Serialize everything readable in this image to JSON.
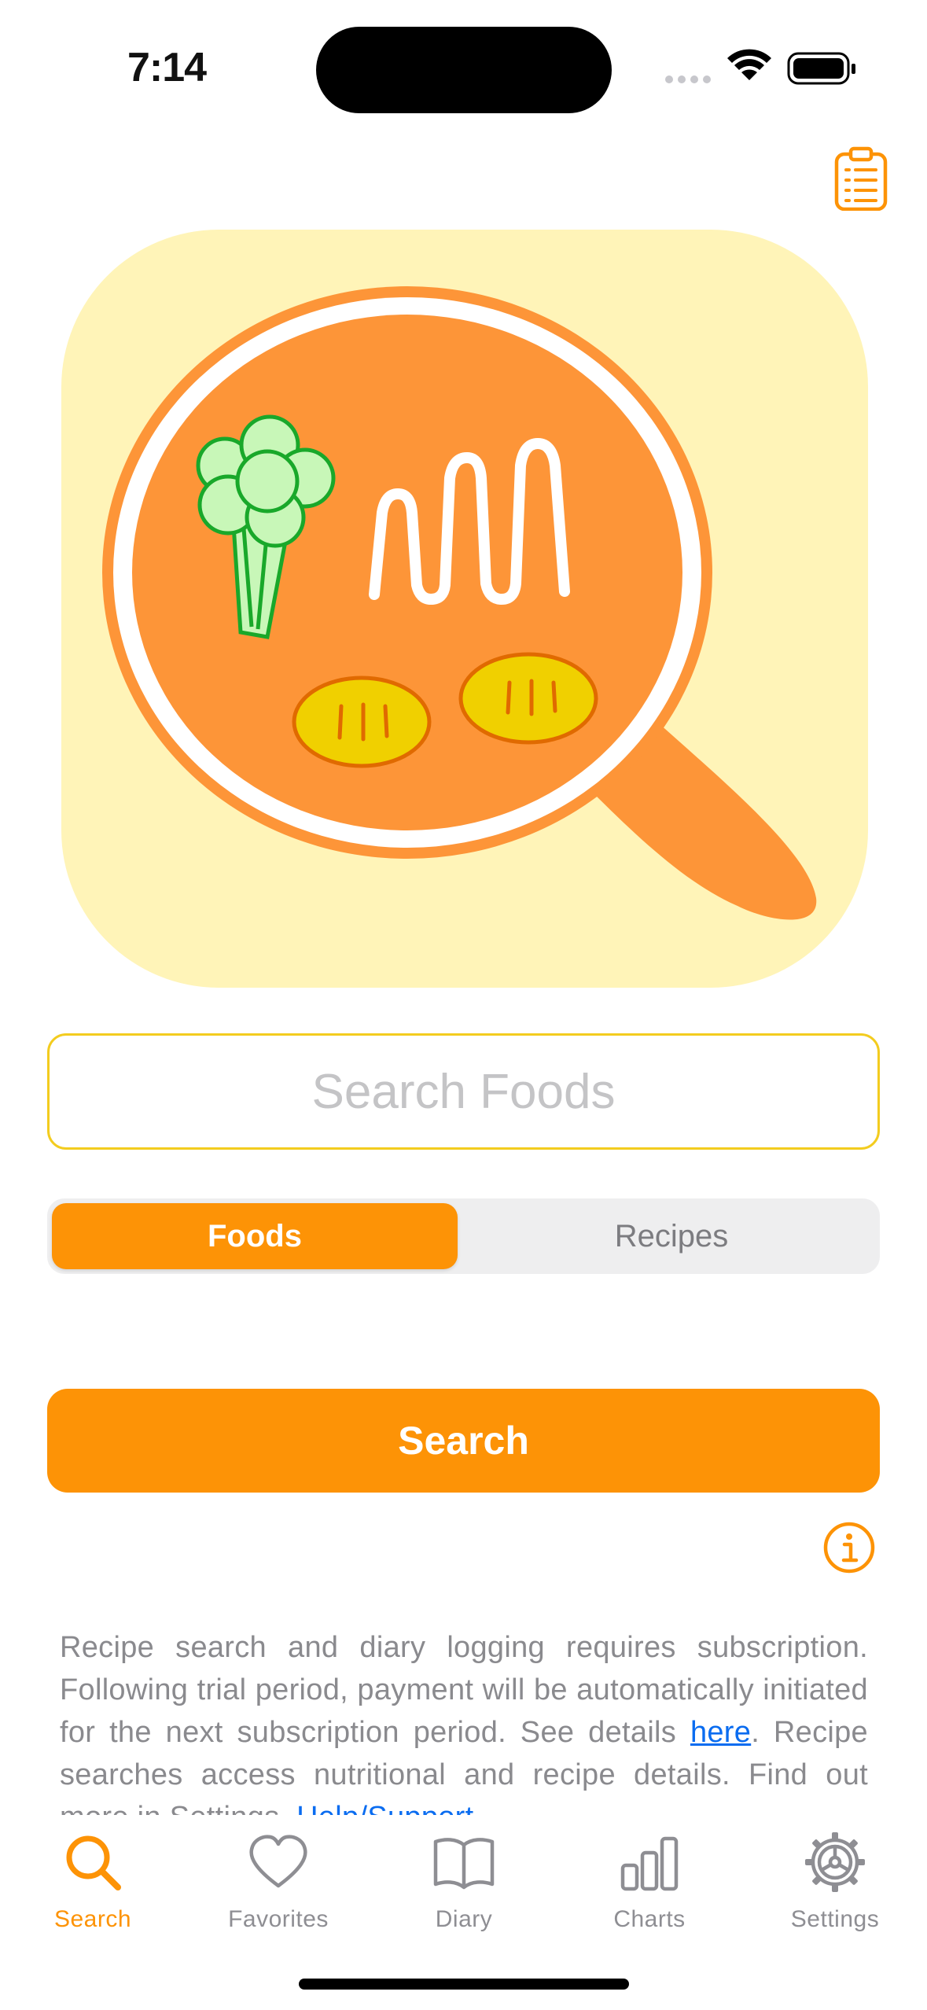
{
  "status_bar": {
    "time": "7:14"
  },
  "colors": {
    "accent": "#fd9306",
    "hero_background": "#fff4b8",
    "input_border": "#f3cc1f",
    "link": "#0a6cf0",
    "inactive_tab": "#8e8e93"
  },
  "header": {
    "clipboard_icon": "clipboard-list-icon"
  },
  "search": {
    "placeholder": "Search Foods",
    "value": ""
  },
  "segmented_control": {
    "options": [
      "Foods",
      "Recipes"
    ],
    "selected": "Foods"
  },
  "search_button": {
    "label": "Search"
  },
  "info_icon": "info-circle-icon",
  "disclaimer": {
    "text_before_link": "Recipe search and diary logging requires subscription. Following trial period, payment will be automatically initiated for the next subscription period. See details ",
    "link1_text": "here",
    "text_middle": ". Recipe searches access nutritional and recipe details. Find out more in Settings, ",
    "link2_text": "Help/Support",
    "text_after": "."
  },
  "tab_bar": {
    "tabs": [
      {
        "label": "Search",
        "icon": "magnifier-icon",
        "active": true
      },
      {
        "label": "Favorites",
        "icon": "heart-icon",
        "active": false
      },
      {
        "label": "Diary",
        "icon": "book-icon",
        "active": false
      },
      {
        "label": "Charts",
        "icon": "bar-chart-icon",
        "active": false
      },
      {
        "label": "Settings",
        "icon": "gear-icon",
        "active": false
      }
    ]
  }
}
